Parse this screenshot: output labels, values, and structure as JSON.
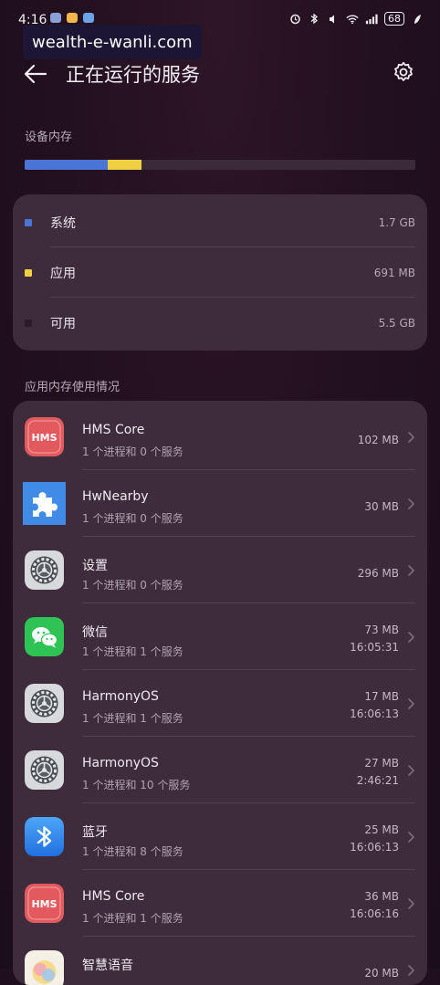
{
  "status_bar": {
    "time": "4:16",
    "battery": "68"
  },
  "watermark": "wealth-e-wanli.com",
  "header": {
    "title": "正在运行的服务"
  },
  "memory": {
    "label": "设备内存",
    "bar": [
      {
        "name": "系统",
        "fraction": 0.2135,
        "color": "#4a74d6"
      },
      {
        "name": "应用",
        "fraction": 0.0865,
        "color": "#f0cf43"
      }
    ],
    "rows": [
      {
        "label": "系统",
        "value": "1.7 GB",
        "color": "#4a74d6"
      },
      {
        "label": "应用",
        "value": "691 MB",
        "color": "#f0cf43"
      },
      {
        "label": "可用",
        "value": "5.5 GB",
        "color": "#2a1a28"
      }
    ]
  },
  "app_usage": {
    "label": "应用内存使用情况",
    "apps": [
      {
        "name": "HMS Core",
        "detail": "1 个进程和 0 个服务",
        "size": "102 MB",
        "time": "",
        "icon": "hms-core-icon",
        "color": "#e1585b"
      },
      {
        "name": "HwNearby",
        "detail": "1 个进程和 0 个服务",
        "size": "30 MB",
        "time": "",
        "icon": "puzzle-icon",
        "color": "#3f8be6"
      },
      {
        "name": "设置",
        "detail": "1 个进程和 0 个服务",
        "size": "296 MB",
        "time": "",
        "icon": "settings-gear-icon",
        "color": "#cfd2d6"
      },
      {
        "name": "微信",
        "detail": "1 个进程和 1 个服务",
        "size": "73 MB",
        "time": "16:05:31",
        "icon": "wechat-icon",
        "color": "#2fc254"
      },
      {
        "name": "HarmonyOS",
        "detail": "1 个进程和 1 个服务",
        "size": "17 MB",
        "time": "16:06:13",
        "icon": "settings-gear-icon",
        "color": "#cfd2d6"
      },
      {
        "name": "HarmonyOS",
        "detail": "1 个进程和 10 个服务",
        "size": "27 MB",
        "time": "2:46:21",
        "icon": "settings-gear-icon",
        "color": "#cfd2d6"
      },
      {
        "name": "蓝牙",
        "detail": "1 个进程和 8 个服务",
        "size": "25 MB",
        "time": "16:06:13",
        "icon": "bluetooth-icon",
        "color": "#2f86f0"
      },
      {
        "name": "HMS Core",
        "detail": "1 个进程和 1 个服务",
        "size": "36 MB",
        "time": "16:06:16",
        "icon": "hms-core-icon",
        "color": "#e1585b"
      },
      {
        "name": "智慧语音",
        "detail": "",
        "size": "20 MB",
        "time": "",
        "icon": "voice-assistant-icon",
        "color": "#f3e2a8"
      }
    ]
  }
}
